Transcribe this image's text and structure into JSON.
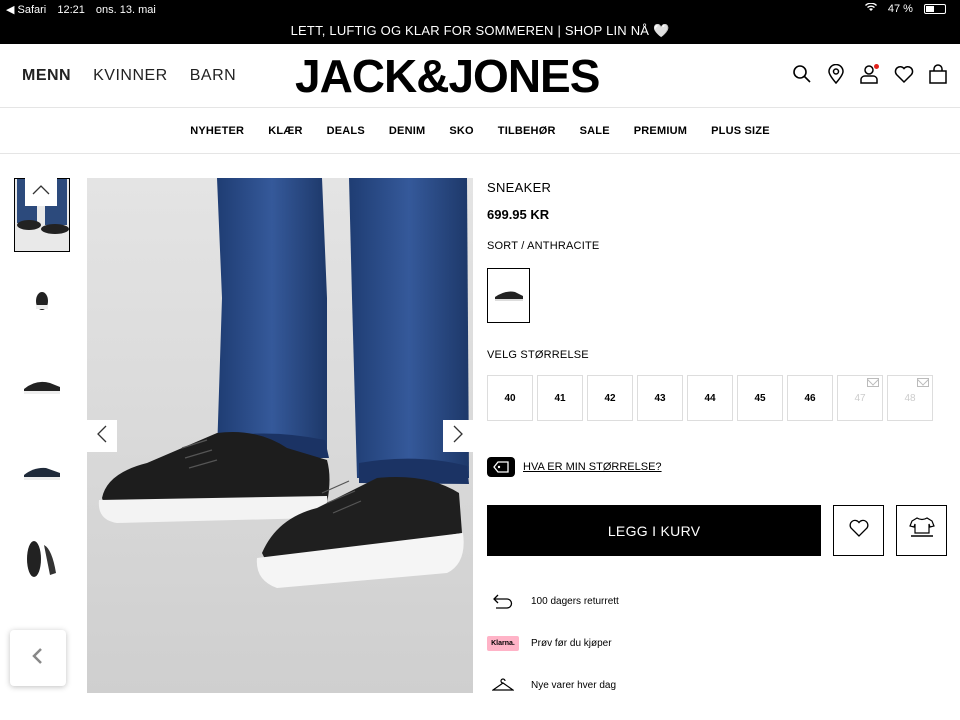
{
  "status_bar": {
    "back_app": "◀ Safari",
    "time": "12:21",
    "date": "ons. 13. mai",
    "battery": "47 %"
  },
  "promo": {
    "text": "LETT, LUFTIG OG KLAR FOR SOMMEREN | SHOP LIN NÅ 🤍"
  },
  "header": {
    "gender_tabs": [
      "MENN",
      "KVINNER",
      "BARN"
    ],
    "logo": "JACK&JONES",
    "icons": [
      "search-icon",
      "location-icon",
      "account-icon",
      "wishlist-icon",
      "bag-icon"
    ]
  },
  "categories": [
    "NYHETER",
    "KLÆR",
    "DEALS",
    "DENIM",
    "SKO",
    "TILBEHØR",
    "SALE",
    "PREMIUM",
    "PLUS SIZE"
  ],
  "product": {
    "name": "SNEAKER",
    "price": "699.95 KR",
    "color_label": "SORT / ANTHRACITE",
    "size_label": "VELG STØRRELSE",
    "sizes": [
      {
        "label": "40",
        "available": true
      },
      {
        "label": "41",
        "available": true
      },
      {
        "label": "42",
        "available": true
      },
      {
        "label": "43",
        "available": true
      },
      {
        "label": "44",
        "available": true
      },
      {
        "label": "45",
        "available": true
      },
      {
        "label": "46",
        "available": true
      },
      {
        "label": "47",
        "available": false
      },
      {
        "label": "48",
        "available": false
      }
    ],
    "size_guide": "HVA ER MIN STØRRELSE?",
    "add_to_cart": "LEGG I KURV"
  },
  "usps": [
    {
      "icon": "return-arrow-icon",
      "text": "100 dagers returrett"
    },
    {
      "icon": "klarna-logo",
      "text": "Prøv før du kjøper",
      "badge": "Klarna."
    },
    {
      "icon": "hanger-icon",
      "text": "Nye varer hver dag"
    }
  ],
  "colors": {
    "notification_dot": "#e0201b",
    "klarna_pink": "#ffb3c7"
  }
}
